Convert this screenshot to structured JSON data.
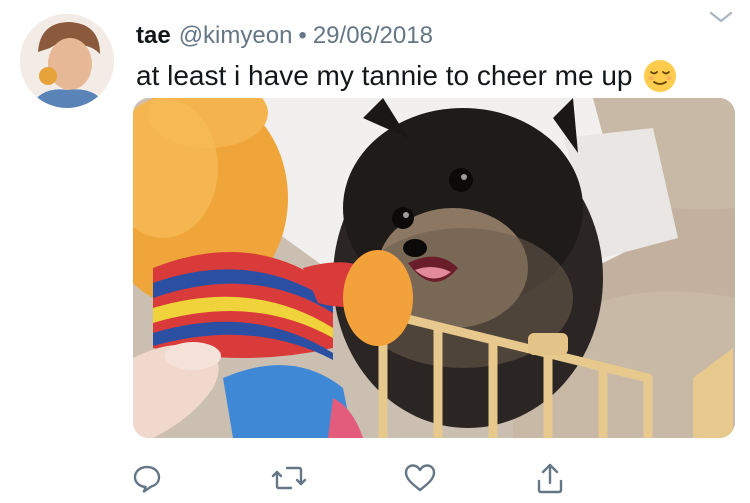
{
  "tweet": {
    "display_name": "tae",
    "handle": "@kimyeon",
    "separator": "•",
    "date": "29/06/2018",
    "text": "at least i have my tannie to cheer me up",
    "emoji": "relieved-face-emoji",
    "avatar": "profile-photo",
    "media": "photo of a black pomeranian puppy barking at an orange puppet held by a hand"
  },
  "actions": [
    {
      "name": "reply",
      "icon": "reply-icon"
    },
    {
      "name": "retweet",
      "icon": "retweet-icon"
    },
    {
      "name": "like",
      "icon": "heart-icon"
    },
    {
      "name": "share",
      "icon": "share-icon"
    }
  ],
  "colors": {
    "text": "#14171a",
    "secondary": "#657786",
    "icon": "#657786"
  }
}
